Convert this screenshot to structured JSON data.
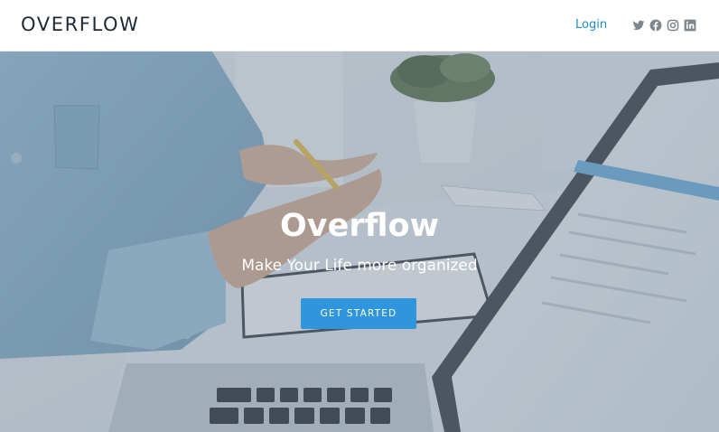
{
  "header": {
    "logo": "OVERFLOW",
    "login_label": "Login",
    "socials": [
      {
        "icon": "twitter-icon"
      },
      {
        "icon": "facebook-icon"
      },
      {
        "icon": "instagram-icon"
      },
      {
        "icon": "linkedin-icon"
      }
    ]
  },
  "hero": {
    "title": "Overflow",
    "subtitle": "Make Your Life more organized",
    "cta_label": "GET STARTED"
  },
  "colors": {
    "accent": "#2f95dc",
    "link": "#1e8bcd",
    "logo_text": "#1f2a36",
    "social_icons": "#7d858d"
  }
}
